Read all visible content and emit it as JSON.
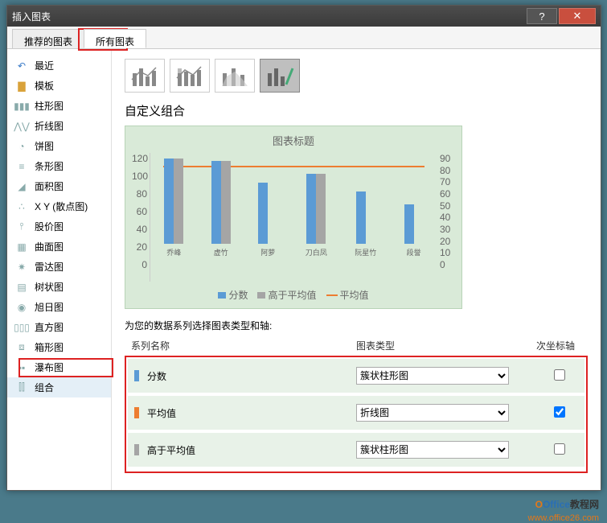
{
  "window": {
    "title": "插入图表",
    "help": "?",
    "close": "✕"
  },
  "tabs": {
    "recommended": "推荐的图表",
    "all": "所有图表"
  },
  "sidebar": [
    {
      "id": "recent",
      "label": "最近"
    },
    {
      "id": "template",
      "label": "模板"
    },
    {
      "id": "column",
      "label": "柱形图"
    },
    {
      "id": "line",
      "label": "折线图"
    },
    {
      "id": "pie",
      "label": "饼图"
    },
    {
      "id": "bar",
      "label": "条形图"
    },
    {
      "id": "area",
      "label": "面积图"
    },
    {
      "id": "xy",
      "label": "X Y (散点图)"
    },
    {
      "id": "stock",
      "label": "股价图"
    },
    {
      "id": "surface",
      "label": "曲面图"
    },
    {
      "id": "radar",
      "label": "雷达图"
    },
    {
      "id": "tree",
      "label": "树状图"
    },
    {
      "id": "sunburst",
      "label": "旭日图"
    },
    {
      "id": "histogram",
      "label": "直方图"
    },
    {
      "id": "boxplot",
      "label": "箱形图"
    },
    {
      "id": "waterfall",
      "label": "瀑布图"
    },
    {
      "id": "combo",
      "label": "组合"
    }
  ],
  "content": {
    "heading": "自定义组合",
    "series_header_label": "为您的数据系列选择图表类型和轴:",
    "col_name": "系列名称",
    "col_type": "图表类型",
    "col_axis": "次坐标轴"
  },
  "chart_data": {
    "type": "bar",
    "title": "图表标题",
    "categories": [
      "乔峰",
      "虚竹",
      "阿萝",
      "刀白凤",
      "阮星竹",
      "段誉"
    ],
    "y1_ticks": [
      120,
      100,
      80,
      60,
      40,
      20,
      0
    ],
    "y2_ticks": [
      90,
      80,
      70,
      60,
      50,
      40,
      30,
      20,
      10,
      0
    ],
    "series": [
      {
        "name": "分数",
        "type": "bar",
        "color": "#5b9bd5",
        "values": [
          98,
          95,
          70,
          80,
          60,
          45
        ]
      },
      {
        "name": "高于平均值",
        "type": "bar",
        "color": "#a5a5a5",
        "values": [
          98,
          95,
          0,
          80,
          0,
          0
        ]
      },
      {
        "name": "平均值",
        "type": "line",
        "color": "#ed7d31",
        "values": [
          75,
          75,
          75,
          75,
          75,
          75
        ]
      }
    ],
    "legend": [
      "分数",
      "高于平均值",
      "平均值"
    ]
  },
  "series_rows": [
    {
      "name": "分数",
      "type": "簇状柱形图",
      "color": "#5b9bd5",
      "secondary": false
    },
    {
      "name": "平均值",
      "type": "折线图",
      "color": "#ed7d31",
      "secondary": true
    },
    {
      "name": "高于平均值",
      "type": "簇状柱形图",
      "color": "#a5a5a5",
      "secondary": false
    }
  ],
  "watermark": {
    "brand1": "O",
    "brand2": "Office",
    "brand3": "教程网",
    "url": "www.office26.com"
  }
}
